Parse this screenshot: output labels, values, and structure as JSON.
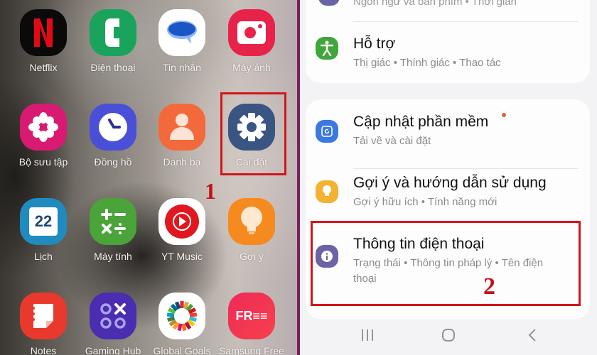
{
  "home_screen": {
    "apps": [
      {
        "label": "Netflix",
        "icon": "netflix-icon",
        "color": "#0a0a0a"
      },
      {
        "label": "Điện thoại",
        "icon": "phone-icon",
        "color": "#1aa35a"
      },
      {
        "label": "Tin nhắn",
        "icon": "messages-icon",
        "color": "#ffffff"
      },
      {
        "label": "Máy ảnh",
        "icon": "camera-icon",
        "color": "#e8234a"
      },
      {
        "label": "Bộ sưu tập",
        "icon": "gallery-icon",
        "color": "#d81a72"
      },
      {
        "label": "Đồng hồ",
        "icon": "clock-icon",
        "color": "#4a4fd8"
      },
      {
        "label": "Danh bạ",
        "icon": "contacts-icon",
        "color": "#f26a3c"
      },
      {
        "label": "Cài đặt",
        "icon": "settings-gear-icon",
        "color": "#3b5583"
      },
      {
        "label": "Lịch",
        "icon": "calendar-icon",
        "color": "#1f8bbf",
        "badge": "22"
      },
      {
        "label": "Máy tính",
        "icon": "calculator-icon",
        "color": "#4aa43a"
      },
      {
        "label": "YT Music",
        "icon": "yt-music-icon",
        "color": "#ffffff"
      },
      {
        "label": "Gợi ý",
        "icon": "tips-bulb-icon",
        "color": "#f68a1e"
      },
      {
        "label": "Notes",
        "icon": "notes-icon",
        "color": "#e8392c"
      },
      {
        "label": "Gaming Hub",
        "icon": "gaming-hub-icon",
        "color": "#4a2db0"
      },
      {
        "label": "Global Goals",
        "icon": "global-goals-icon",
        "color": "#ffffff"
      },
      {
        "label": "Samsung Free",
        "icon": "samsung-free-icon",
        "color": "#f0295a",
        "glyph": "FR≡≡"
      }
    ],
    "step_label": "1"
  },
  "settings": {
    "partial_top_subtitle": "Ngôn ngữ và bàn phím  •  Thời gian",
    "items": [
      {
        "title": "Hỗ trợ",
        "subtitle": "Thị giác  •  Thính giác  •  Thao tác",
        "icon": "accessibility-icon",
        "color": "#3fa63b"
      },
      {
        "title": "Cập nhật phần mềm",
        "subtitle": "Tải về và cài đặt",
        "icon": "software-update-icon",
        "color": "#3b78e0",
        "has_dot": true
      },
      {
        "title": "Gợi ý và hướng dẫn sử dụng",
        "subtitle": "Gợi ý hữu ích  •  Tính năng mới",
        "icon": "tips-icon",
        "color": "#f5b132"
      },
      {
        "title": "Thông tin điện thoại",
        "subtitle": "Trạng thái  •  Thông tin pháp lý  •  Tên điện thoại",
        "icon": "info-icon",
        "color": "#6a63a8"
      }
    ],
    "step_label": "2",
    "nav": {
      "recents": "recents-icon",
      "home": "home-icon",
      "back": "back-icon"
    }
  },
  "colors": {
    "highlight": "#d0161b",
    "update_dot": "#e0642a"
  }
}
